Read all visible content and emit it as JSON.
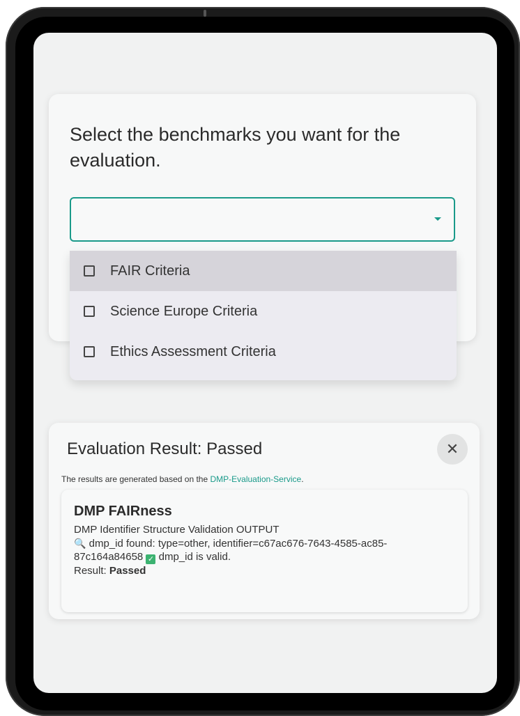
{
  "benchmarks": {
    "title": "Select the benchmarks you want for the evaluation.",
    "select_value": "",
    "options": [
      {
        "label": "FAIR Criteria",
        "checked": false
      },
      {
        "label": "Science Europe Criteria",
        "checked": false
      },
      {
        "label": "Ethics Assessment Criteria",
        "checked": false
      }
    ]
  },
  "result": {
    "title": "Evaluation Result: Passed",
    "close_label": "✕",
    "note_prefix": "The results are generated based on the ",
    "note_link": "DMP-Evaluation-Service",
    "note_suffix": ".",
    "card": {
      "title": "DMP FAIRness",
      "line1": "DMP Identifier Structure Validation OUTPUT",
      "line2": " dmp_id found: type=other, identifier=c67ac676-7643-4585-ac85-87c164a84658 ",
      "line3": " dmp_id is valid.",
      "result_label": "Result: ",
      "result_value": "Passed"
    }
  },
  "icons": {
    "search": "magnifier-icon",
    "valid": "checkmark-box-icon",
    "close": "close-icon"
  },
  "colors": {
    "accent": "#1a9a8a",
    "valid": "#3cb371"
  }
}
